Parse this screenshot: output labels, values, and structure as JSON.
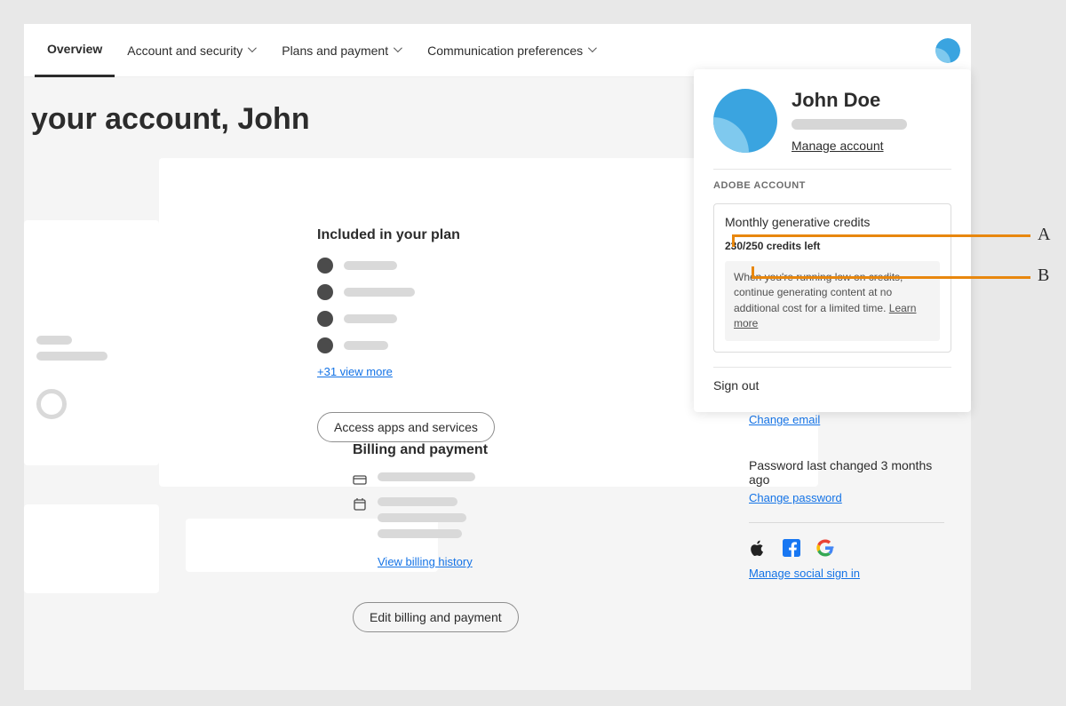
{
  "nav": {
    "overview": "Overview",
    "account_security": "Account and security",
    "plans_payment": "Plans and payment",
    "comm_prefs": "Communication preferences"
  },
  "page": {
    "title": "your account, John"
  },
  "included": {
    "title": "Included in your plan",
    "more_link": "+31 view more",
    "access_btn": "Access apps and services"
  },
  "billing": {
    "title": "Billing and payment",
    "history_link": "View billing history",
    "edit_btn": "Edit billing and payment"
  },
  "right": {
    "change_email": "Change email",
    "password_note": "Password last changed 3 months ago",
    "change_password": "Change password",
    "manage_social": "Manage social sign in"
  },
  "popover": {
    "name": "John Doe",
    "manage_account": "Manage account",
    "section_label": "ADOBE ACCOUNT",
    "credit_title": "Monthly generative credits",
    "credit_sub": "230/250 credits left",
    "credit_note": "When you're running low on credits, continue generating content at no additional cost for a limited time.",
    "learn_more": "Learn more",
    "sign_out": "Sign out"
  },
  "callouts": {
    "a": "A",
    "b": "B"
  }
}
